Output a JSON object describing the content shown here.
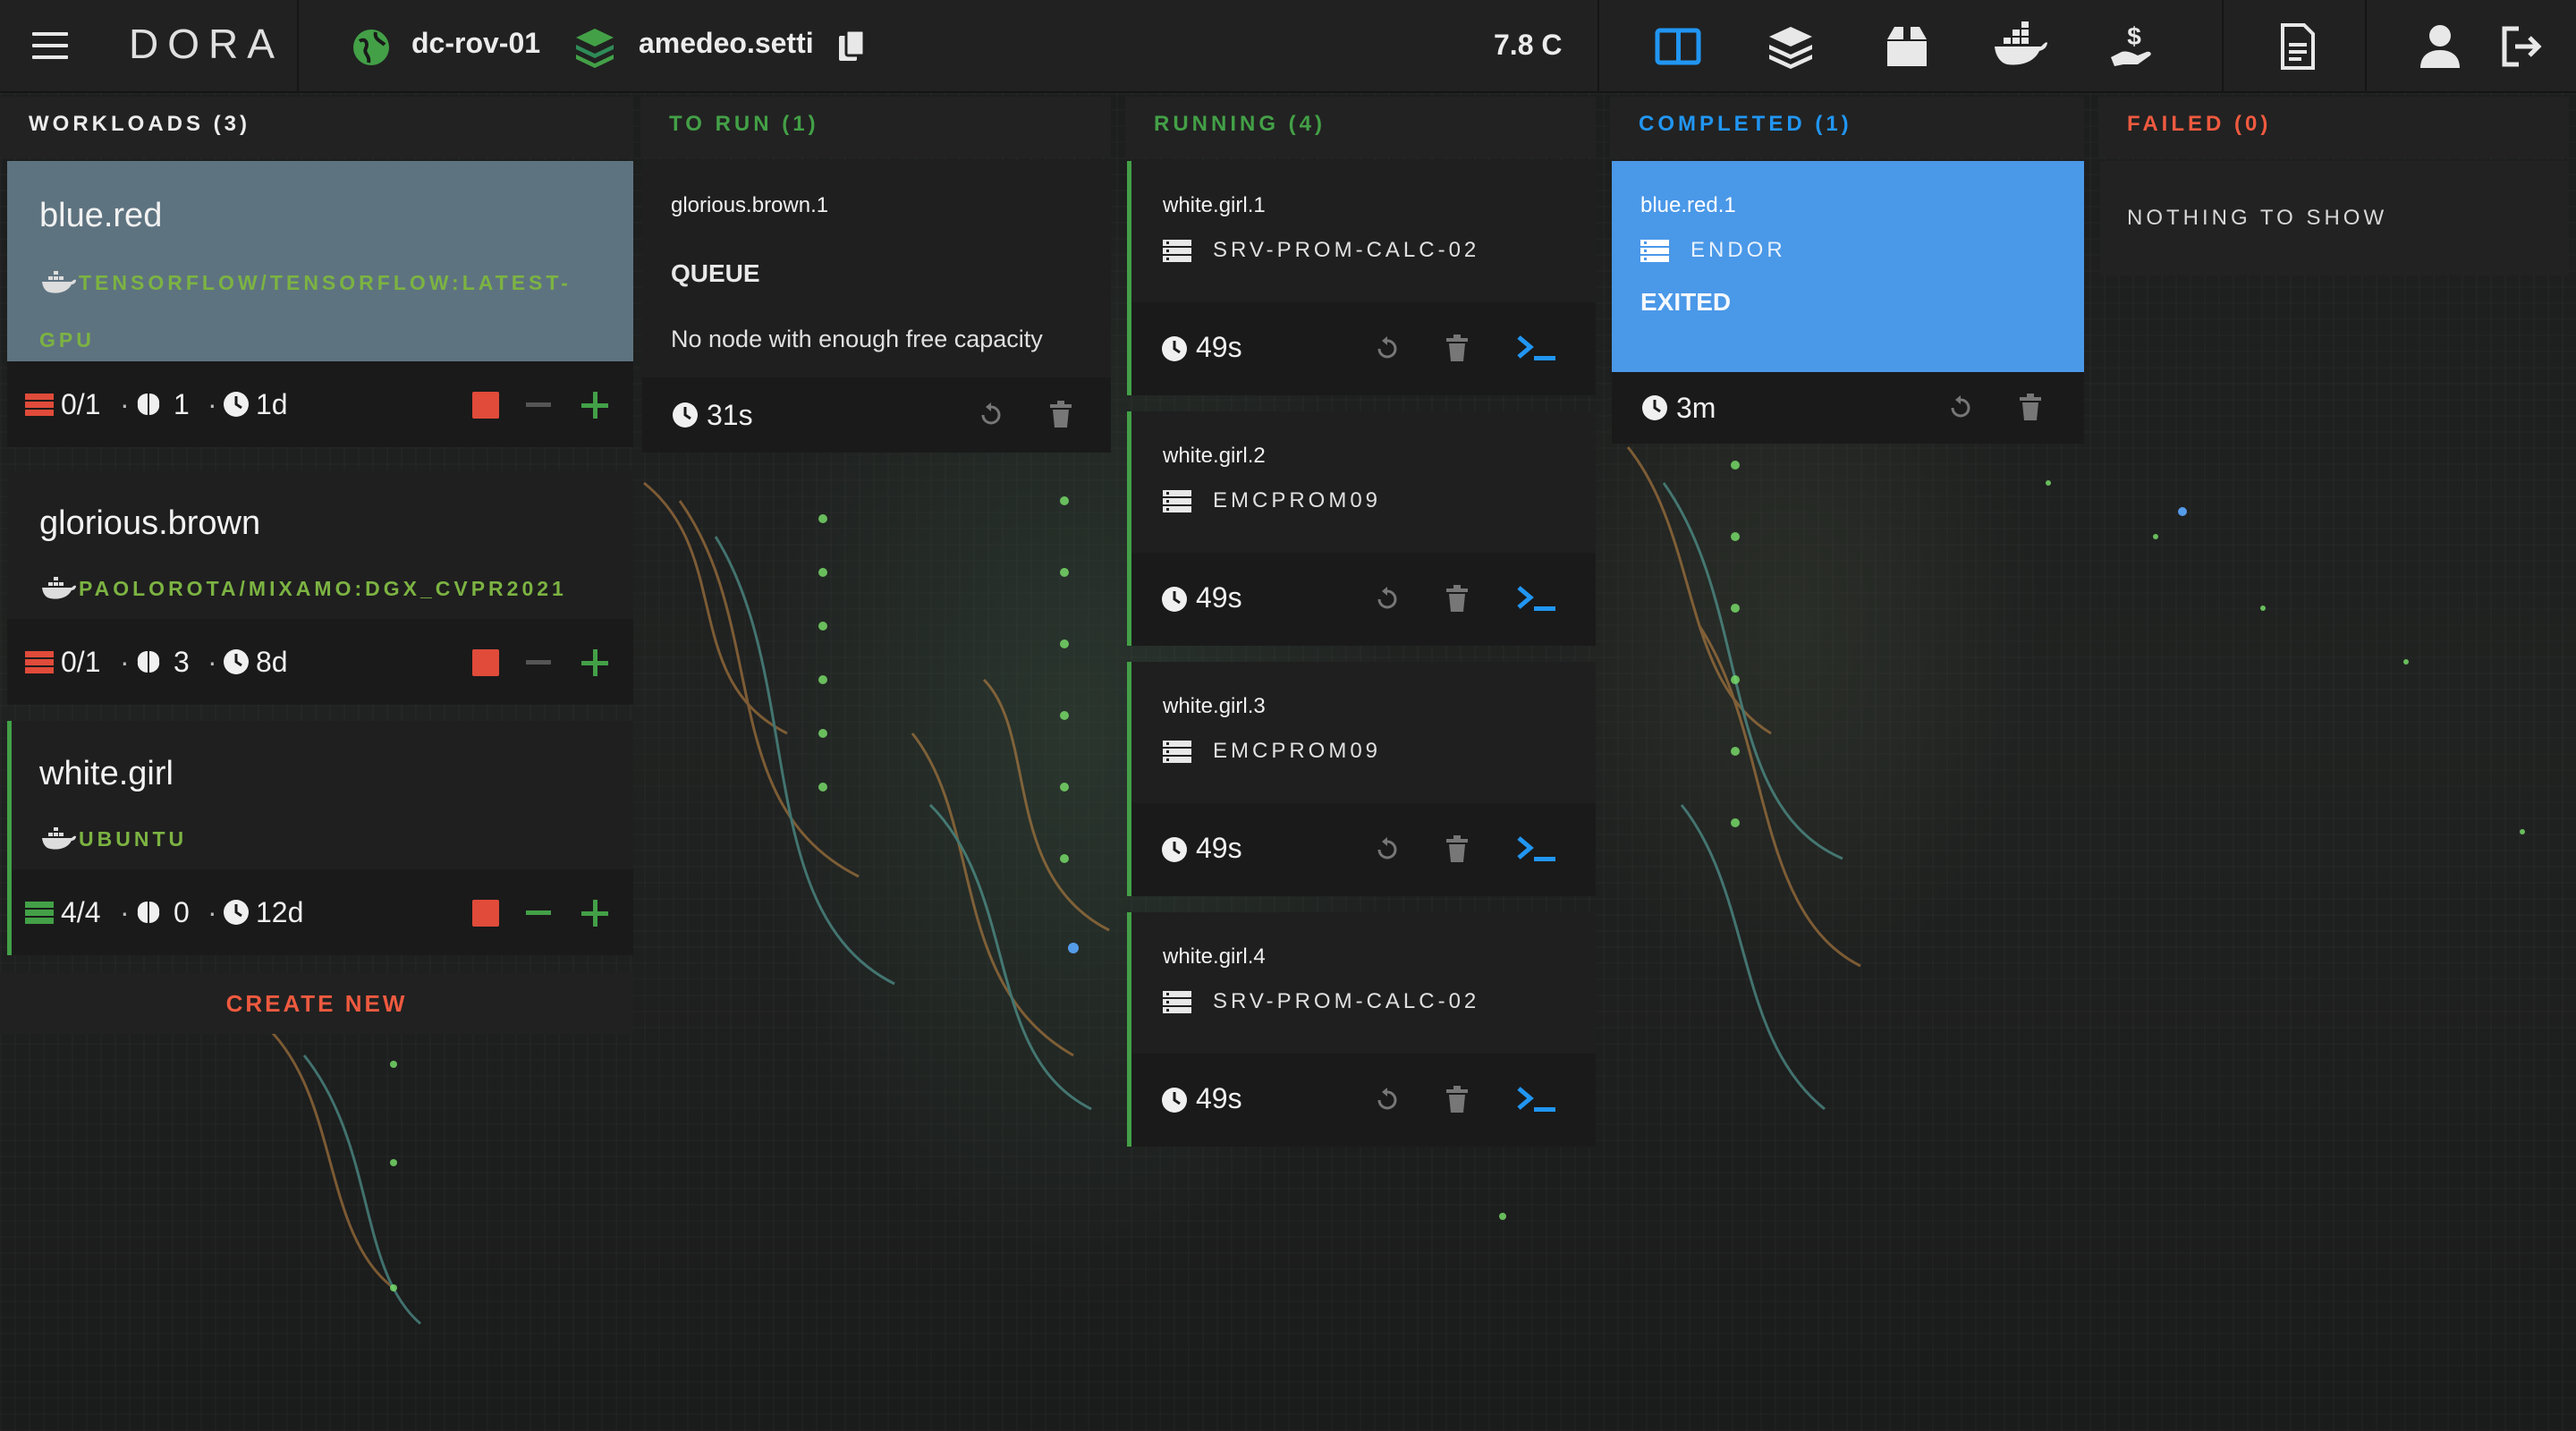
{
  "app": {
    "brand": "DORA",
    "zone": "dc-rov-01",
    "user": "amedeo.setti",
    "temperature": "7.8 C"
  },
  "colors": {
    "accent_blue": "#2196f3",
    "green": "#43a047",
    "red": "#e04b3a",
    "lime": "#7cb342",
    "selected_card": "#5e7380",
    "completed_card": "#4a98e8"
  },
  "nav": {
    "icons": [
      "board-icon",
      "layers-icon",
      "package-icon",
      "docker-icon",
      "money-hand-icon",
      "document-icon",
      "user-icon",
      "logout-icon"
    ],
    "active": "board-icon"
  },
  "columns": {
    "workloads": "WORKLOADS (3)",
    "to_run": "TO RUN (1)",
    "running": "RUNNING (4)",
    "completed": "COMPLETED (1)",
    "failed": "FAILED (0)"
  },
  "workloads": [
    {
      "name": "blue.red",
      "image": "TENSORFLOW/TENSORFLOW:LATEST-",
      "image2": "GPU",
      "replicas": "0/1",
      "gpus": "1",
      "age": "1d",
      "selected": true
    },
    {
      "name": "glorious.brown",
      "image": "PAOLOROTA/MIXAMO:DGX_CVPR2021",
      "replicas": "0/1",
      "gpus": "3",
      "age": "8d"
    },
    {
      "name": "white.girl",
      "image": "UBUNTU",
      "replicas": "4/4",
      "gpus": "0",
      "age": "12d"
    }
  ],
  "create_new": "CREATE NEW",
  "to_run": [
    {
      "name": "glorious.brown.1",
      "status": "QUEUE",
      "reason": "No node with enough free capacity",
      "elapsed": "31s"
    }
  ],
  "running": [
    {
      "name": "white.girl.1",
      "node": "SRV-PROM-CALC-02",
      "elapsed": "49s"
    },
    {
      "name": "white.girl.2",
      "node": "EMCPROM09",
      "elapsed": "49s"
    },
    {
      "name": "white.girl.3",
      "node": "EMCPROM09",
      "elapsed": "49s"
    },
    {
      "name": "white.girl.4",
      "node": "SRV-PROM-CALC-02",
      "elapsed": "49s"
    }
  ],
  "completed": [
    {
      "name": "blue.red.1",
      "node": "ENDOR",
      "status": "EXITED",
      "elapsed": "3m"
    }
  ],
  "failed_empty": "NOTHING TO SHOW"
}
